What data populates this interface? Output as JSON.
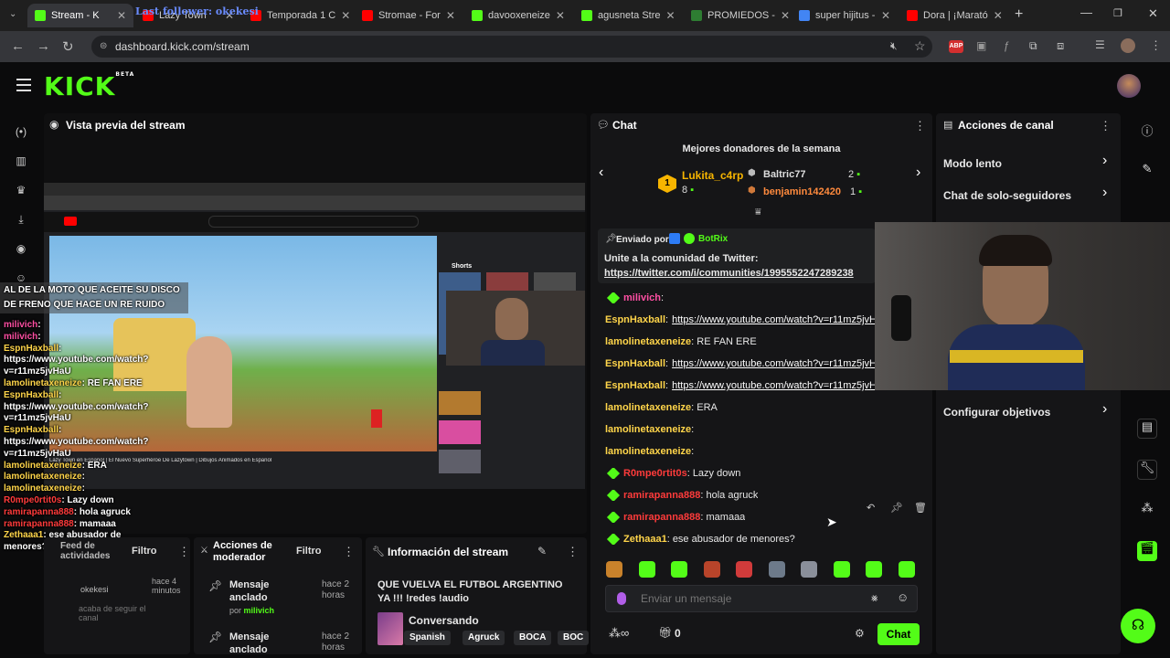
{
  "browser": {
    "tabs": [
      {
        "label": "Stream - K",
        "active": true,
        "color": "#53fc18"
      },
      {
        "label": "Lazy Town",
        "color": "#ff0000"
      },
      {
        "label": "Temporada 1 C",
        "color": "#ff0000"
      },
      {
        "label": "Stromae - For",
        "color": "#ff0000"
      },
      {
        "label": "davooxeneize",
        "color": "#53fc18"
      },
      {
        "label": "agusneta Stre",
        "color": "#53fc18"
      },
      {
        "label": "PROMIEDOS -",
        "color": "#2e7d32"
      },
      {
        "label": "super hijitus -",
        "color": "#4285f4"
      },
      {
        "label": "Dora | ¡Marató",
        "color": "#ff0000"
      }
    ],
    "overlay_follower": "Last follower: okekesi",
    "url": "dashboard.kick.com/stream"
  },
  "app": {
    "logo": "KICK",
    "logo_badge": "BETA"
  },
  "preview": {
    "title": "Vista previa del stream",
    "yt_title": "Lazy Town en Español | El Nuevo Superhéroe De Lazytown | Dibujos Animados en Español",
    "shorts_label": "Shorts",
    "alert_line1": "AL DE LA MOTO QUE ACEITE SU DISCO",
    "alert_line2": "DE FRENO QUE HACE UN RE RUIDO",
    "overlay_chat": [
      {
        "user": "milivich",
        "text": ":",
        "color": "#ff4fa3"
      },
      {
        "user": "milivich",
        "text": ":",
        "color": "#ff4fa3"
      },
      {
        "user": "EspnHaxball",
        "text": ":",
        "color": "#ffd54a"
      },
      {
        "user": "",
        "text": "https://www.youtube.com/watch?",
        "color": "#fff"
      },
      {
        "user": "",
        "text": "v=r11mz5jvHaU",
        "color": "#fff"
      },
      {
        "user": "lamolinetaxeneize",
        "text": ": RE FAN ERE",
        "color": "#ffd54a"
      },
      {
        "user": "EspnHaxball",
        "text": ":",
        "color": "#ffd54a"
      },
      {
        "user": "",
        "text": "https://www.youtube.com/watch?",
        "color": "#fff"
      },
      {
        "user": "",
        "text": "v=r11mz5jvHaU",
        "color": "#fff"
      },
      {
        "user": "EspnHaxball",
        "text": ":",
        "color": "#ffd54a"
      },
      {
        "user": "",
        "text": "https://www.youtube.com/watch?",
        "color": "#fff"
      },
      {
        "user": "",
        "text": "v=r11mz5jvHaU",
        "color": "#fff"
      },
      {
        "user": "lamolinetaxeneize",
        "text": ": ERA",
        "color": "#ffd54a"
      },
      {
        "user": "lamolinetaxeneize",
        "text": ":",
        "color": "#ffd54a"
      },
      {
        "user": "lamolinetaxeneize",
        "text": ":",
        "color": "#ffd54a"
      },
      {
        "user": "R0mpe0rtit0s",
        "text": ": Lazy down",
        "color": "#ff3b3b"
      },
      {
        "user": "ramirapanna888",
        "text": ": hola agruck",
        "color": "#ff3b3b"
      },
      {
        "user": "ramirapanna888",
        "text": ": mamaaa",
        "color": "#ff3b3b"
      },
      {
        "user": "Zethaaa1",
        "text": ": ese abusador de",
        "color": "#ffd54a"
      },
      {
        "user": "",
        "text": "menores?",
        "color": "#fff"
      }
    ]
  },
  "activity": {
    "title": "Feed de actividades",
    "filter": "Filtro",
    "time": "hace 4 minutos",
    "follower_note": "okekesi",
    "follower_text": "acaba de seguir el canal"
  },
  "moderator": {
    "title": "Acciones de moderador",
    "filter": "Filtro",
    "items": [
      {
        "label": "Mensaje anclado",
        "by": "por",
        "user": "milivich",
        "time": "hace 2 horas"
      },
      {
        "label": "Mensaje anclado",
        "time": "hace 2 horas"
      }
    ]
  },
  "streaminfo": {
    "title": "Información del stream",
    "stream_title": "QUE VUELVA EL FUTBOL ARGENTINO YA !!! !redes !audio",
    "category": "Conversando",
    "tags": [
      "Spanish",
      "Agruck",
      "BOCA",
      "BOC"
    ]
  },
  "chat": {
    "title": "Chat",
    "donors_title": "Mejores donadores de la semana",
    "donors": [
      {
        "rank": "1",
        "name": "Lukita_c4rp",
        "amount": "8"
      },
      {
        "name": "Baltric77",
        "amount": "2"
      },
      {
        "name": "benjamin142420",
        "amount": "1"
      }
    ],
    "pinned_by_label": "Enviado por",
    "pinned_by_user": "BotRix",
    "pinned_text": "Unite a la comunidad de Twitter:",
    "pinned_link": "https://twitter.com/i/communities/1995552247289238",
    "messages": [
      {
        "user": "milivich",
        "text": ":",
        "color": "#ff4fa3"
      },
      {
        "user": "EspnHaxball",
        "text": ":",
        "link": "https://www.youtube.com/watch?v=r11mz5jvH",
        "color": "#ffd54a"
      },
      {
        "user": "lamolinetaxeneize",
        "text": ": RE FAN ERE",
        "color": "#ffd54a"
      },
      {
        "user": "EspnHaxball",
        "text": ":",
        "link": "https://www.youtube.com/watch?v=r11mz5jvH",
        "color": "#ffd54a"
      },
      {
        "user": "EspnHaxball",
        "text": ":",
        "link": "https://www.youtube.com/watch?v=r11mz5jvH",
        "color": "#ffd54a"
      },
      {
        "user": "lamolinetaxeneize",
        "text": ": ERA",
        "color": "#ffd54a"
      },
      {
        "user": "lamolinetaxeneize",
        "text": ":",
        "color": "#ffd54a"
      },
      {
        "user": "lamolinetaxeneize",
        "text": ":",
        "color": "#ffd54a"
      },
      {
        "user": "R0mpe0rtit0s",
        "text": ": Lazy down",
        "color": "#ff3b3b"
      },
      {
        "user": "ramirapanna888",
        "text": ": hola agruck",
        "color": "#ff3b3b"
      },
      {
        "user": "ramirapanna888",
        "text": ": mamaaa",
        "color": "#ff3b3b"
      },
      {
        "user": "Zethaaa1",
        "text": ": ese abusador de menores?",
        "color": "#ffd54a"
      }
    ],
    "input_placeholder": "Enviar un mensaje",
    "points": "0",
    "send_label": "Chat"
  },
  "channel_actions": {
    "title": "Acciones de canal",
    "items": [
      "Modo lento",
      "Chat de solo-seguidores"
    ],
    "goals": "Configurar objetivos"
  },
  "colors": {
    "brand": "#53fc18",
    "panel": "#151517",
    "bg": "#0b0b0c"
  }
}
